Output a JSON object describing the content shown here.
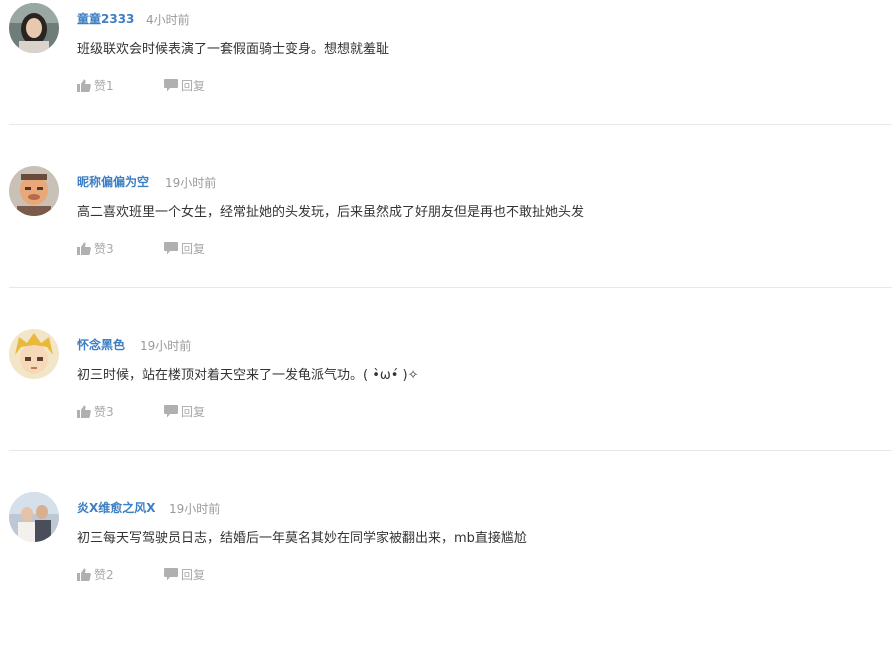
{
  "comments": [
    {
      "username": "童童2333",
      "time": "4小时前",
      "content": "班级联欢会时候表演了一套假面骑士变身。想想就羞耻",
      "like_label": "赞1",
      "reply_label": "回复",
      "avatar_icon": "avatar-girl-photo"
    },
    {
      "username": "昵称偏偏为空",
      "time": "19小时前",
      "content": "高二喜欢班里一个女生，经常扯她的头发玩，后来虽然成了好朋友但是再也不敢扯她头发",
      "like_label": "赞3",
      "reply_label": "回复",
      "avatar_icon": "avatar-cartoon-old-man"
    },
    {
      "username": "怀念黑色",
      "time": "19小时前",
      "content": "初三时候，站在楼顶对着天空来了一发龟派气功。( •̀ω•́ )✧",
      "like_label": "赞3",
      "reply_label": "回复",
      "avatar_icon": "avatar-anime-blonde-boy"
    },
    {
      "username": "炎X维愈之风X",
      "time": "19小时前",
      "content": "初三每天写驾驶员日志，结婚后一年莫名其妙在同学家被翻出来，mb直接尴尬",
      "like_label": "赞2",
      "reply_label": "回复",
      "avatar_icon": "avatar-couple-photo"
    }
  ],
  "colors": {
    "username": "#3d7fc4",
    "meta": "#9a9a9a",
    "text": "#333333",
    "action": "#a8a8a8",
    "divider": "#e8e8e8"
  }
}
